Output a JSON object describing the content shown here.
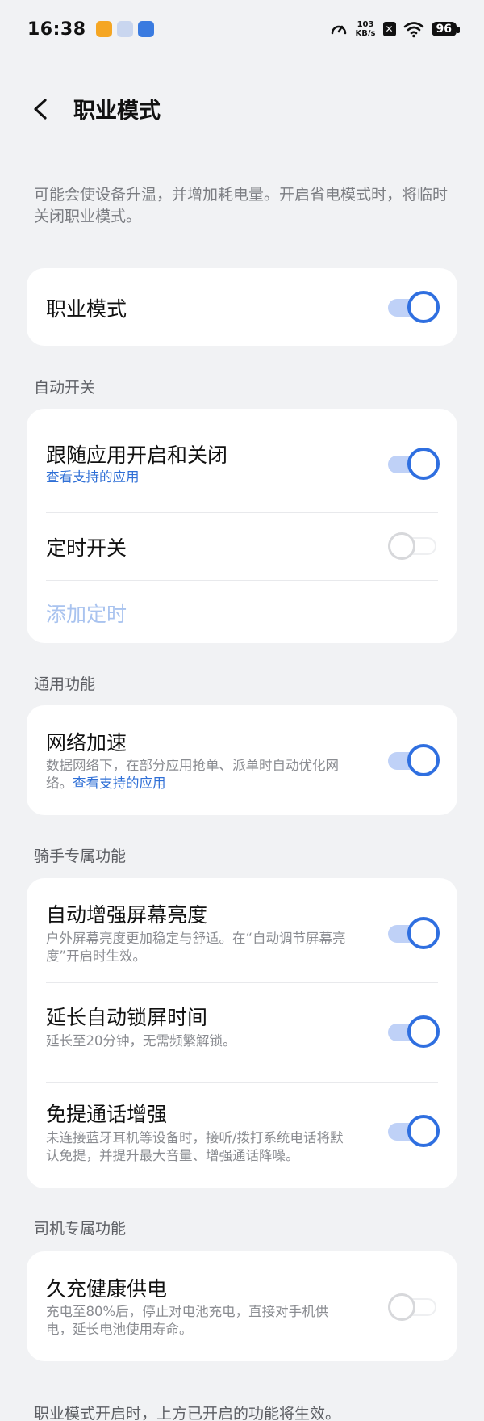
{
  "status_bar": {
    "time": "16:38",
    "speed_value": "103",
    "speed_unit": "KB/s",
    "battery": "96",
    "x_icon_text": "✕"
  },
  "header": {
    "title": "职业模式"
  },
  "intro_text": "可能会使设备升温，并增加耗电量。开启省电模式时，将临时关闭职业模式。",
  "main_toggle": {
    "label": "职业模式",
    "on": true
  },
  "sections": {
    "auto_switch": "自动开关",
    "general": "通用功能",
    "rider": "骑手专属功能",
    "driver": "司机专属功能"
  },
  "auto_switch": {
    "follow_app_title": "跟随应用开启和关闭",
    "follow_app_link": "查看支持的应用",
    "follow_app_on": true,
    "timer_title": "定时开关",
    "timer_on": false,
    "add_timer": "添加定时"
  },
  "general": {
    "network_title": "网络加速",
    "network_desc": "数据网络下，在部分应用抢单、派单时自动优化网络。",
    "network_link": "查看支持的应用",
    "network_on": true
  },
  "rider": {
    "brightness_title": "自动增强屏幕亮度",
    "brightness_desc": "户外屏幕亮度更加稳定与舒适。在“自动调节屏幕亮度”开启时生效。",
    "brightness_on": true,
    "lock_title": "延长自动锁屏时间",
    "lock_desc": "延长至20分钟，无需频繁解锁。",
    "lock_on": true,
    "call_title": "免提通话增强",
    "call_desc": "未连接蓝牙耳机等设备时，接听/拨打系统电话将默认免提，并提升最大音量、增强通话降噪。",
    "call_on": true
  },
  "driver": {
    "power_title": "久充健康供电",
    "power_desc": "充电至80%后，停止对电池充电，直接对手机供电，延长电池使用寿命。",
    "power_on": false
  },
  "footer_text": "职业模式开启时，上方已开启的功能将生效。",
  "colors": {
    "accent": "#2f6fe0",
    "link": "#2f6fd6",
    "background": "#f1f2f4",
    "disabled_text": "#a9c3ef"
  }
}
